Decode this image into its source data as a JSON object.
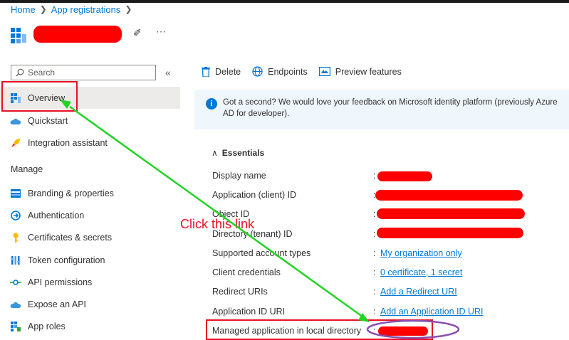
{
  "breadcrumb": {
    "home": "Home",
    "app_registrations": "App registrations"
  },
  "sidebar": {
    "search_placeholder": "Search",
    "items": [
      {
        "label": "Overview"
      },
      {
        "label": "Quickstart"
      },
      {
        "label": "Integration assistant"
      }
    ],
    "manage_label": "Manage",
    "manage_items": [
      {
        "label": "Branding & properties"
      },
      {
        "label": "Authentication"
      },
      {
        "label": "Certificates & secrets"
      },
      {
        "label": "Token configuration"
      },
      {
        "label": "API permissions"
      },
      {
        "label": "Expose an API"
      },
      {
        "label": "App roles"
      }
    ]
  },
  "toolbar": {
    "delete": "Delete",
    "endpoints": "Endpoints",
    "preview": "Preview features"
  },
  "banner": {
    "text": "Got a second? We would love your feedback on Microsoft identity platform (previously Azure AD for developer)."
  },
  "essentials": {
    "title": "Essentials",
    "display_name": "Display name",
    "client_id": "Application (client) ID",
    "object_id": "Object ID",
    "tenant_id": "Directory (tenant) ID",
    "account_types": "Supported account types",
    "account_types_value": "My organization only",
    "client_credentials": "Client credentials",
    "client_credentials_value": "0 certificate, 1 secret",
    "redirect_uris": "Redirect URIs",
    "redirect_uris_value": "Add a Redirect URI",
    "app_id_uri": "Application ID URI",
    "app_id_uri_value": "Add an Application ID URI",
    "managed_app": "Managed application in local directory",
    "colon": ":"
  },
  "annotation": {
    "text": "Click this link"
  },
  "colors": {
    "accent": "#0078d4",
    "annotation_red": "#e81123",
    "arrow_green": "#22d322",
    "ellipse_purple": "#8a4fb0"
  }
}
